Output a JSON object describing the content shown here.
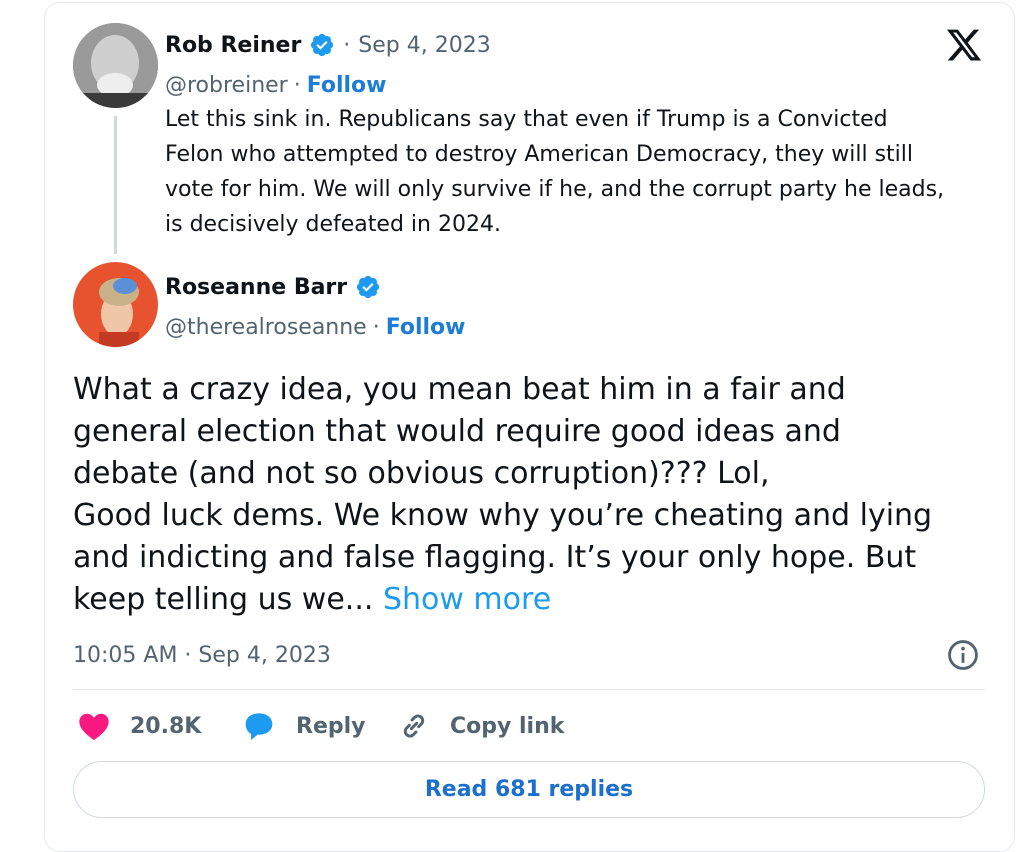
{
  "quoted_tweet": {
    "author_name": "Rob Reiner",
    "handle": "@robreiner",
    "separator": "·",
    "date": "Sep 4, 2023",
    "follow_label": "Follow",
    "text_lines": [
      "Let this sink in. Republicans say that even if Trump is a Convicted",
      "Felon who attempted to destroy American Democracy, they will still",
      "vote for him. We will only survive if he, and the corrupt party he leads,",
      "is decisively defeated in 2024."
    ]
  },
  "reply_tweet": {
    "author_name": "Roseanne Barr",
    "handle": "@therealroseanne",
    "separator": "·",
    "follow_label": "Follow",
    "text_lines": [
      "What a crazy idea, you mean beat him in a fair and",
      "general election that would require good ideas and",
      "debate (and not so obvious corruption)??? Lol,",
      "Good luck dems. We know why you’re cheating and lying",
      "and indicting and false flagging. It’s your only hope. But",
      "keep telling us we..."
    ],
    "show_more_label": "Show more",
    "timestamp": "10:05 AM · Sep 4, 2023"
  },
  "actions": {
    "like_count": "20.8K",
    "reply_label": "Reply",
    "copy_link_label": "Copy link"
  },
  "read_replies_label": "Read 681 replies",
  "colors": {
    "link_blue": "#1d9bf0",
    "verified_blue": "#1d9bf0",
    "like_pink": "#f91880",
    "muted_gray": "#536471"
  },
  "icons": [
    "x-logo-icon",
    "verified-badge-icon",
    "info-icon",
    "heart-icon",
    "reply-bubble-icon",
    "link-icon"
  ]
}
